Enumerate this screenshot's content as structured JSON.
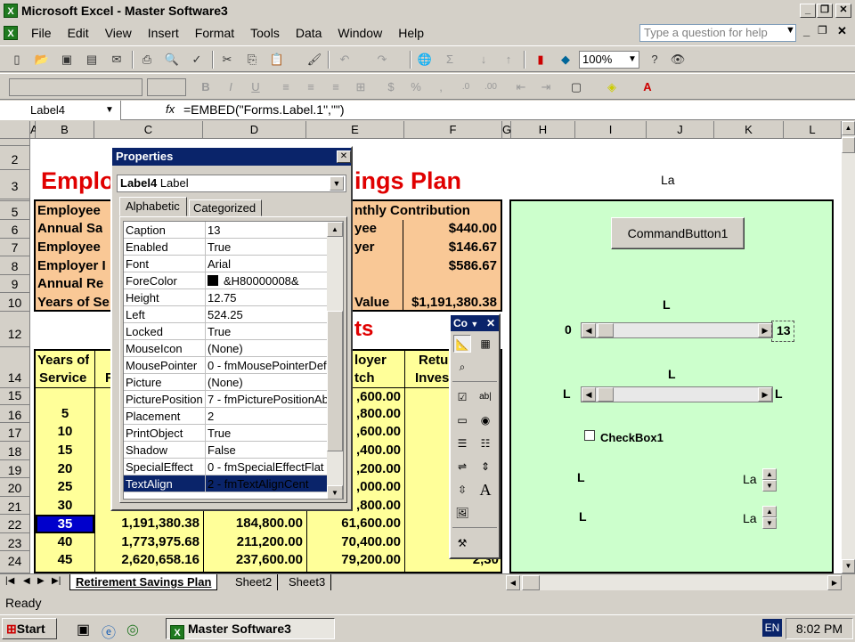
{
  "window": {
    "title": "Microsoft Excel - Master Software3"
  },
  "menu": [
    "File",
    "Edit",
    "View",
    "Insert",
    "Format",
    "Tools",
    "Data",
    "Window",
    "Help"
  ],
  "ask_placeholder": "Type a question for help",
  "toolbar": {
    "zoom": "100%"
  },
  "formula": {
    "name_box": "Label4",
    "fx": "fx",
    "content": "=EMBED(\"Forms.Label.1\",\"\")"
  },
  "columns": [
    "A",
    "B",
    "C",
    "D",
    "E",
    "F",
    "G",
    "H",
    "I",
    "J",
    "K",
    "L"
  ],
  "rows": [
    "2",
    "3",
    "5",
    "6",
    "7",
    "8",
    "9",
    "10",
    "12",
    "14",
    "15",
    "16",
    "17",
    "18",
    "19",
    "20",
    "21",
    "22",
    "23",
    "24"
  ],
  "sheet": {
    "title_left": "Emplo",
    "title_right": "ings Plan",
    "label_la": "La",
    "r12_right": "ts",
    "info_left": [
      "Employee",
      "Annual Sa",
      "Employee",
      "Employer I",
      "Annual Re",
      "Years of Se"
    ],
    "info_mid": [
      "nthly Contribution",
      "yee",
      "yer",
      "",
      "",
      "Value"
    ],
    "info_values": [
      "$440.00",
      "$146.67",
      "$586.67",
      "",
      "",
      "$1,191,380.38"
    ],
    "hdr_years": [
      "Years of",
      "Service"
    ],
    "hdr_b": "F",
    "hdr_employer": [
      "loyer",
      "tch"
    ],
    "hdr_return": [
      "Retu",
      "Inves"
    ],
    "years": [
      "",
      "5",
      "10",
      "15",
      "20",
      "25",
      "30",
      "35",
      "40",
      "45"
    ],
    "col_c": [
      "",
      "",
      "",
      "",
      "",
      "",
      "",
      "1,191,380.38",
      "1,773,975.68",
      "2,620,658.16"
    ],
    "col_d": [
      "",
      "",
      "",
      "",
      "",
      "",
      "",
      "184,800.00",
      "211,200.00",
      "237,600.00"
    ],
    "col_e": [
      ",600.00",
      ",800.00",
      ",600.00",
      ",400.00",
      ",200.00",
      ",000.00",
      ",800.00",
      "61,600.00",
      "70,400.00",
      "79,200.00"
    ],
    "col_f": [
      "$94",
      "",
      "3",
      "8",
      "18",
      "33",
      "57",
      "94",
      "1,49",
      "2,30"
    ]
  },
  "form": {
    "command_button": "CommandButton1",
    "label_l": "L",
    "scroll1_min": "0",
    "scroll1_val": "13",
    "checkbox": "CheckBox1",
    "spin_label": "La"
  },
  "properties": {
    "title": "Properties",
    "object": "Label4",
    "object_type": "Label",
    "tabs": [
      "Alphabetic",
      "Categorized"
    ],
    "rows": [
      {
        "name": "Caption",
        "value": "13"
      },
      {
        "name": "Enabled",
        "value": "True"
      },
      {
        "name": "Font",
        "value": "Arial"
      },
      {
        "name": "ForeColor",
        "value": "&H80000008&"
      },
      {
        "name": "Height",
        "value": "12.75"
      },
      {
        "name": "Left",
        "value": "524.25"
      },
      {
        "name": "Locked",
        "value": "True"
      },
      {
        "name": "MouseIcon",
        "value": "(None)"
      },
      {
        "name": "MousePointer",
        "value": "0 - fmMousePointerDefa"
      },
      {
        "name": "Picture",
        "value": "(None)"
      },
      {
        "name": "PicturePosition",
        "value": "7 - fmPicturePositionAbo"
      },
      {
        "name": "Placement",
        "value": "2"
      },
      {
        "name": "PrintObject",
        "value": "True"
      },
      {
        "name": "Shadow",
        "value": "False"
      },
      {
        "name": "SpecialEffect",
        "value": "0 - fmSpecialEffectFlat"
      },
      {
        "name": "TextAlign",
        "value": "2 - fmTextAlignCent"
      }
    ]
  },
  "toolbox": {
    "title": "Co"
  },
  "sheet_tabs": [
    "Retirement Savings Plan",
    "Sheet2",
    "Sheet3"
  ],
  "status": "Ready",
  "taskbar": {
    "start": "Start",
    "app": "Master Software3",
    "lang": "EN",
    "time": "8:02 PM"
  },
  "colors": {
    "title_red": "#e00000",
    "orange_fill": "#f9c896",
    "yellow_fill": "#ffff99",
    "green_fill": "#ccffcc",
    "selection_blue": "#0000cc"
  }
}
